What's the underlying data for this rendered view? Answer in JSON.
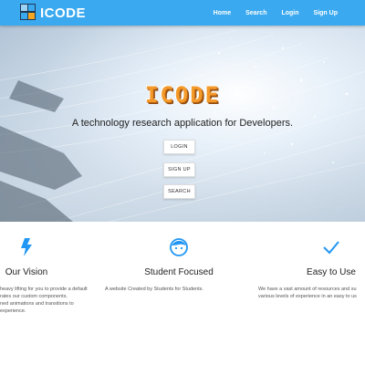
{
  "nav": {
    "brand": "ICODE",
    "links": [
      "Home",
      "Search",
      "Login",
      "Sign Up"
    ]
  },
  "hero": {
    "title": "ICODE",
    "subtitle": "A technology research application for Developers.",
    "buttons": [
      "LOGIN",
      "SIGN UP",
      "SEARCH"
    ]
  },
  "features": [
    {
      "icon": "bolt-icon",
      "title": "Our Vision",
      "lines": [
        "heavy lifting for you to provide a default",
        "rates our custom components.",
        "ned animations and transitions to",
        "experience."
      ]
    },
    {
      "icon": "face-icon",
      "title": "Student Focused",
      "lines": [
        "A website Created by Students for Students."
      ]
    },
    {
      "icon": "check-icon",
      "title": "Easy to Use",
      "lines": [
        "We have a vast amount of resources and su",
        "various levels of experience in an easy to us"
      ]
    }
  ],
  "colors": {
    "primary": "#3aa9ef",
    "accent": "#f39a2b"
  }
}
